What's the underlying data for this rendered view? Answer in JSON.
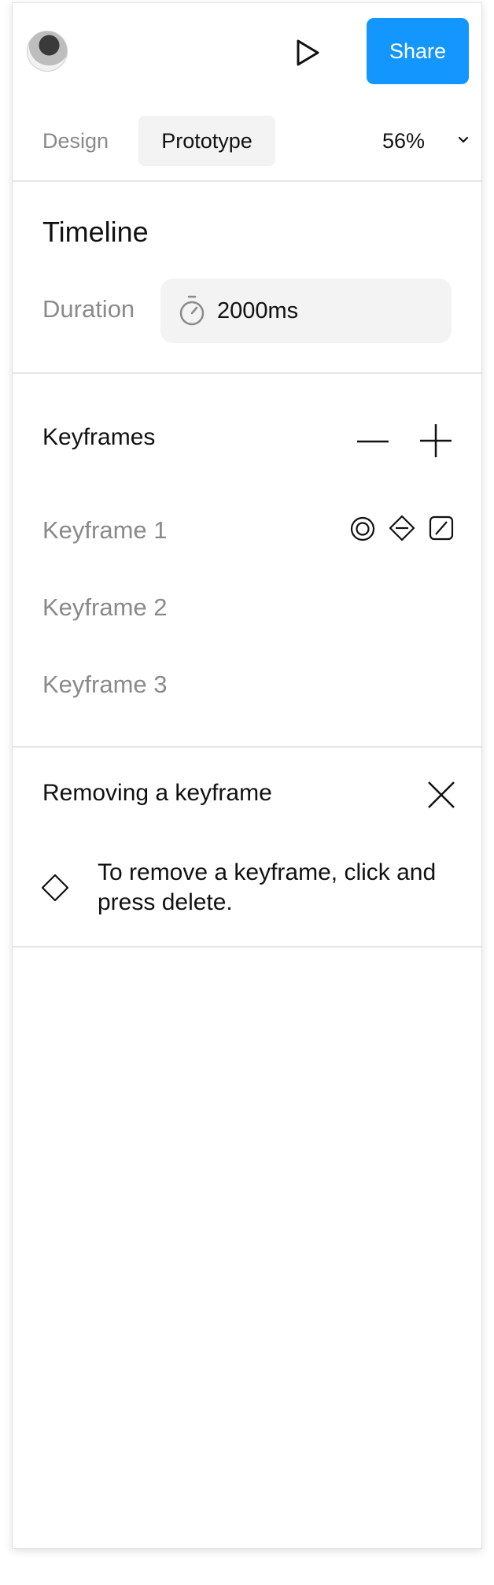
{
  "header": {
    "avatar_alt": "user avatar",
    "share_label": "Share",
    "share_color": "#1496ff"
  },
  "tabs": {
    "design": "Design",
    "prototype": "Prototype",
    "active": "Prototype"
  },
  "zoom": {
    "value": "56%"
  },
  "timeline": {
    "title": "Timeline",
    "duration_label": "Duration",
    "duration_value": "2000ms"
  },
  "keyframes": {
    "title": "Keyframes",
    "items": [
      {
        "label": "Keyframe 1"
      },
      {
        "label": "Keyframe 2"
      },
      {
        "label": "Keyframe 3"
      }
    ]
  },
  "info": {
    "title": "Removing a keyframe",
    "text": "To remove a keyframe, click and press delete."
  },
  "icons": [
    "play-icon",
    "chevron-down-icon",
    "stopwatch-icon",
    "minus-icon",
    "plus-icon",
    "target-icon",
    "diamond-minus-icon",
    "easing-curve-icon",
    "close-icon",
    "diamond-icon"
  ]
}
